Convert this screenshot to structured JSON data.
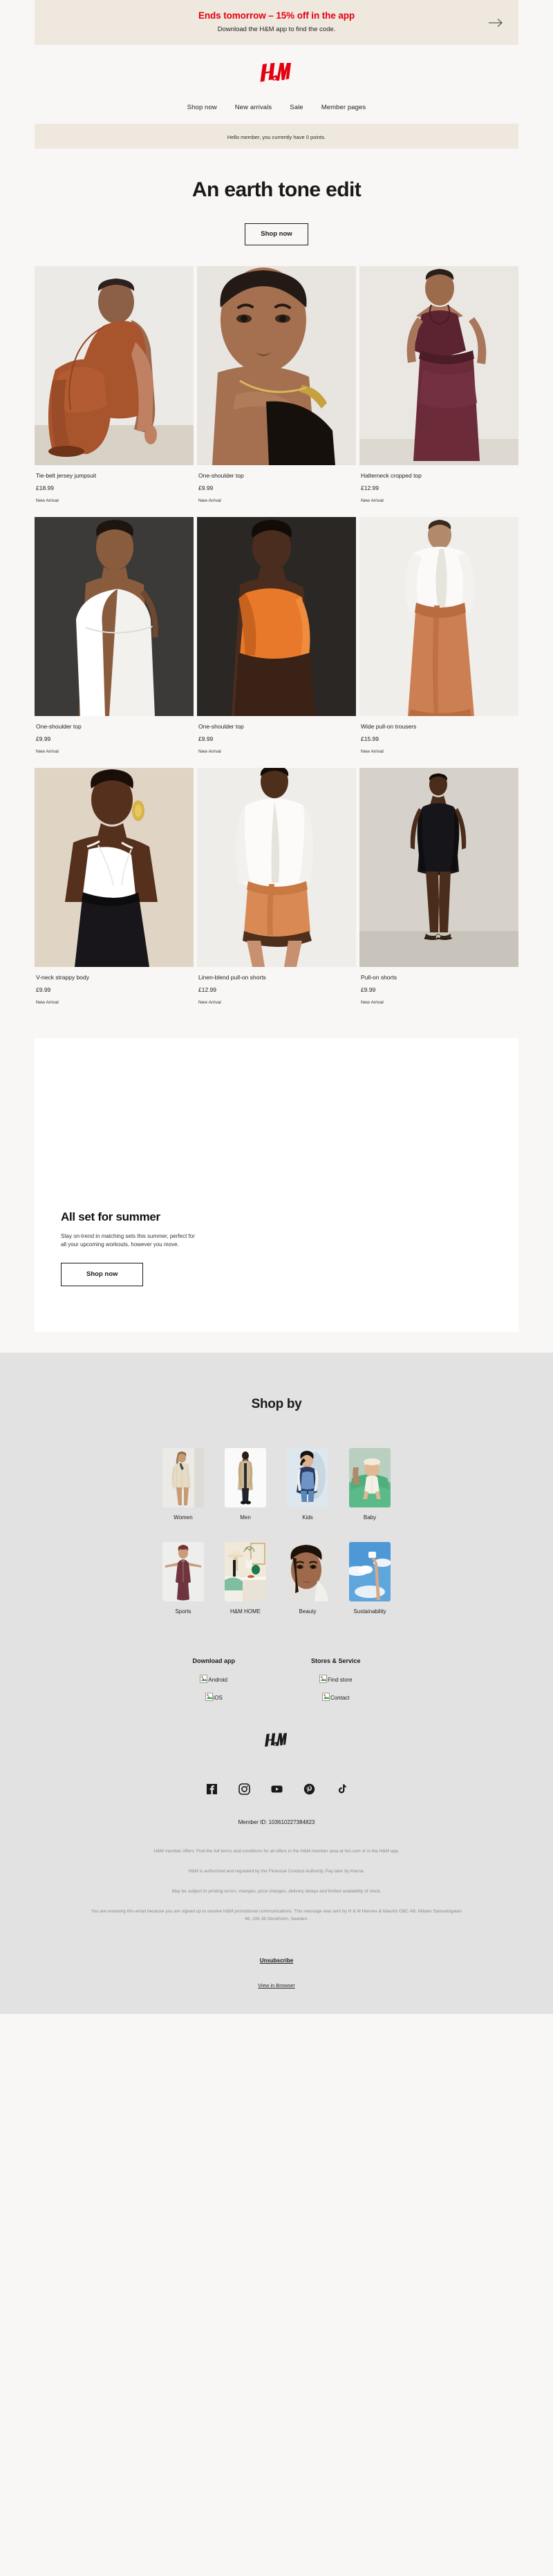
{
  "promo_banner": {
    "title": "Ends tomorrow – 15% off in the app",
    "subtitle": "Download the H&M app to find the code.",
    "arrow_icon": "arrow-right-icon"
  },
  "brand": {
    "logo_alt": "H&M",
    "accent_color": "#e50010"
  },
  "nav": {
    "items": [
      {
        "label": "Shop now"
      },
      {
        "label": "New arrivals"
      },
      {
        "label": "Sale"
      },
      {
        "label": "Member pages"
      }
    ]
  },
  "member_strip": {
    "text": "Hello member, you currently have 0 points."
  },
  "hero": {
    "title": "An earth tone edit",
    "cta": "Shop now"
  },
  "products": [
    {
      "name": "Tie-belt jersey jumpsuit",
      "price": "£18.99",
      "tag": "New Arrival",
      "image": "model-seated-rust-jumpsuit"
    },
    {
      "name": "One-shoulder top",
      "price": "£9.99",
      "tag": "New Arrival",
      "image": "model-closeup-black-one-shoulder"
    },
    {
      "name": "Halterneck cropped top",
      "price": "£12.99",
      "tag": "New Arrival",
      "image": "model-burgundy-halterneck"
    },
    {
      "name": "One-shoulder top",
      "price": "£9.99",
      "tag": "New Arrival",
      "image": "model-white-one-shoulder-dark-bg"
    },
    {
      "name": "One-shoulder top",
      "price": "£9.99",
      "tag": "New Arrival",
      "image": "model-orange-top-back"
    },
    {
      "name": "Wide pull-on trousers",
      "price": "£15.99",
      "tag": "New Arrival",
      "image": "model-rust-wide-trousers-white-shirt"
    },
    {
      "name": "V-neck strappy body",
      "price": "£9.99",
      "tag": "New Arrival",
      "image": "model-white-body-black-skirt"
    },
    {
      "name": "Linen-blend pull-on shorts",
      "price": "£12.99",
      "tag": "New Arrival",
      "image": "model-linen-shorts-white-shirt"
    },
    {
      "name": "Pull-on shorts",
      "price": "£9.99",
      "tag": "New Arrival",
      "image": "model-black-shorts-full-body"
    }
  ],
  "promo_card": {
    "title": "All set for summer",
    "body": "Stay on-trend in matching sets this summer, perfect for all your upcoming workouts, however you move.",
    "cta": "Shop now"
  },
  "shop_by": {
    "title": "Shop by",
    "categories": [
      {
        "label": "Women",
        "image": "woman-beige-cardigan"
      },
      {
        "label": "Men",
        "image": "man-trench-coat"
      },
      {
        "label": "Kids",
        "image": "kid-denim-jacket"
      },
      {
        "label": "Baby",
        "image": "baby-green-armchair"
      },
      {
        "label": "Sports",
        "image": "woman-sports-bodysuit"
      },
      {
        "label": "H&M HOME",
        "image": "home-interior-lamp-vase"
      },
      {
        "label": "Beauty",
        "image": "beauty-portrait"
      },
      {
        "label": "Sustainability",
        "image": "hand-cloud-sky"
      }
    ]
  },
  "footer": {
    "columns": [
      {
        "heading": "Download app",
        "links": [
          {
            "label": "Android",
            "icon": "broken-image-icon"
          },
          {
            "label": "iOS",
            "icon": "broken-image-icon"
          }
        ]
      },
      {
        "heading": "Stores & Service",
        "links": [
          {
            "label": "Find store",
            "icon": "broken-image-icon"
          },
          {
            "label": "Contact",
            "icon": "broken-image-icon"
          }
        ]
      }
    ],
    "socials": [
      {
        "name": "facebook-icon"
      },
      {
        "name": "instagram-icon"
      },
      {
        "name": "youtube-icon"
      },
      {
        "name": "pinterest-icon"
      },
      {
        "name": "tiktok-icon"
      }
    ],
    "member_id_label": "Member ID:",
    "member_id_value": "103610227384823",
    "legal": [
      "H&M member offers: Find the full terms and conditions for all offers in the H&M member area at hm.com or in the H&M app.",
      "H&M is authorized and regulated by the Financial Conduct Authority, Pay later by Klarna.",
      "May be subject to printing errors, changes, price changes, delivery delays and limited availability of stock.",
      "You are receiving this email because you are signed up to receive H&M promotional communications. This message was sent by H & M Hennes & Mauritz GBC AB, Mäster Samuelsgatan 46, 106 38 Stockholm, Sweden."
    ],
    "unsubscribe": "Unsubscribe",
    "view_in_browser": "View in Browser"
  }
}
